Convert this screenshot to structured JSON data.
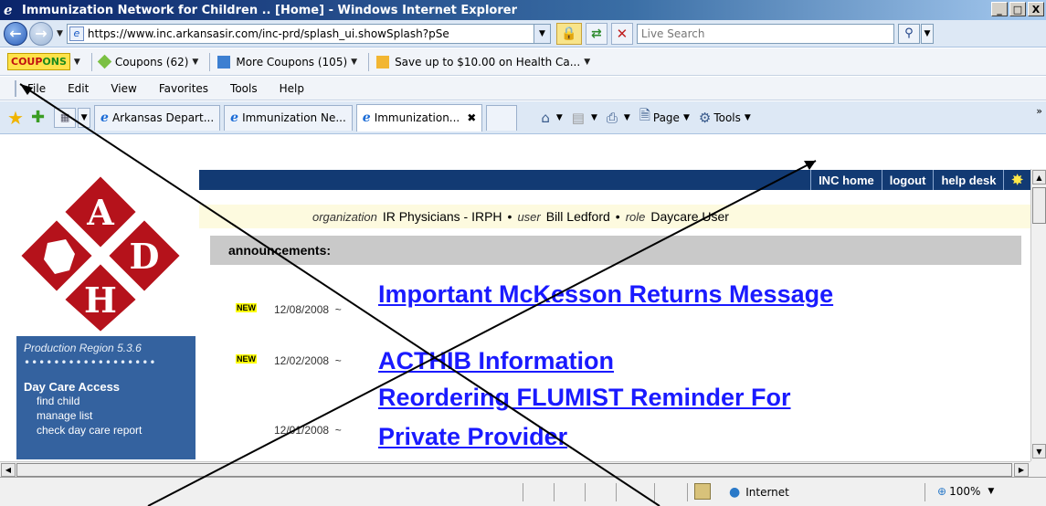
{
  "window": {
    "title": "Immunization Network for Children .. [Home] - Windows Internet Explorer",
    "minimize": "_",
    "maximize": "□",
    "close": "X"
  },
  "address": {
    "url": "https://www.inc.arkansasir.com/inc-prd/splash_ui.showSplash?pSe",
    "search_placeholder": "Live Search"
  },
  "coupons_bar": {
    "logo_a": "COUP",
    "logo_b": "ONS",
    "items": [
      "Coupons (62)",
      "More Coupons (105)",
      "Save up to $10.00 on Health Ca..."
    ]
  },
  "menu": [
    "File",
    "Edit",
    "View",
    "Favorites",
    "Tools",
    "Help"
  ],
  "tabs": [
    {
      "label": "Arkansas Depart...",
      "active": false
    },
    {
      "label": "Immunization Ne...",
      "active": false
    },
    {
      "label": "Immunization...",
      "active": true
    }
  ],
  "commands": {
    "page": "Page",
    "tools": "Tools"
  },
  "site": {
    "logo_letters": [
      "A",
      "D",
      "H"
    ],
    "region": "Production Region 5.3.6",
    "dots": "••••••••••••••••••",
    "section": "Day Care Access",
    "links": [
      "find child",
      "manage list",
      "check day care report"
    ],
    "nav": [
      "INC home",
      "logout",
      "help desk"
    ],
    "org": {
      "org_label": "organization",
      "org_value": "IR Physicians - IRPH",
      "user_label": "user",
      "user_value": "Bill Ledford",
      "role_label": "role",
      "role_value": "Daycare User",
      "sep": "•"
    },
    "announcements_header": "announcements:",
    "announcements": [
      {
        "badge": "NEW",
        "date": "12/08/2008",
        "tilde": "~",
        "title": "Important McKesson Returns Message"
      },
      {
        "badge": "NEW",
        "date": "12/02/2008",
        "tilde": "~",
        "title": "ACTHIB Information"
      },
      {
        "badge": "",
        "date": "12/01/2008",
        "tilde": "~",
        "title_line1": "Reordering FLUMIST Reminder For",
        "title_line2": "Private Provider"
      }
    ]
  },
  "status": {
    "zone": "Internet",
    "zoom": "100%"
  },
  "colors": {
    "nav_bg": "#123a73",
    "sidebar_bg": "#34629f",
    "link": "#1a1aff",
    "logo_red": "#b5121b"
  }
}
